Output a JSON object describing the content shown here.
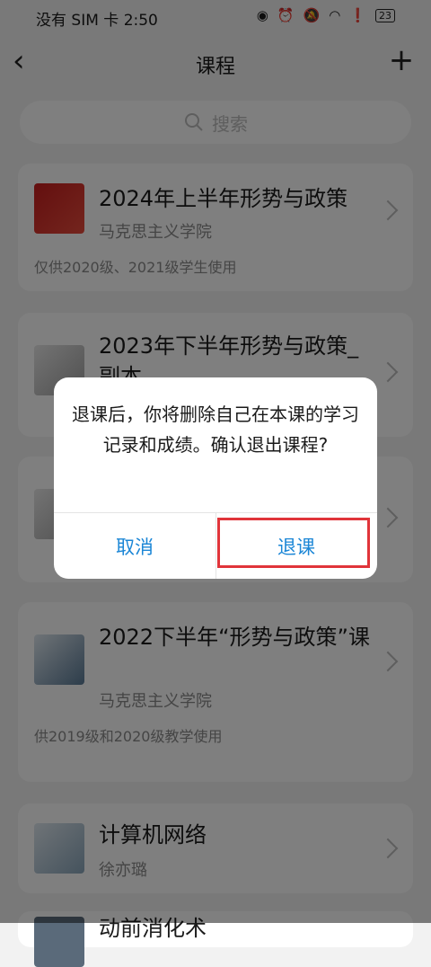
{
  "status_bar": {
    "carrier": "没有 SIM 卡",
    "time": "2:50",
    "battery": "23"
  },
  "header": {
    "title": "课程"
  },
  "search": {
    "placeholder": "搜索"
  },
  "courses": [
    {
      "title": "2024年上半年形势与政策",
      "teacher": "马克思主义学院",
      "note": "仅供2020级、2021级学生使用"
    },
    {
      "title": "2023年下半年形势与政策_副本",
      "teacher": "",
      "note": ""
    },
    {
      "title": "",
      "teacher": "",
      "note": ""
    },
    {
      "title": "2022下半年“形势与政策”课",
      "teacher": "马克思主义学院",
      "note": "供2019级和2020级教学使用"
    },
    {
      "title": "计算机网络",
      "teacher": "徐亦璐",
      "note": ""
    },
    {
      "title": "动前消化术",
      "teacher": "",
      "note": ""
    }
  ],
  "dialog": {
    "message": "退课后，你将删除自己在本课的学习记录和成绩。确认退出课程?",
    "cancel_label": "取消",
    "confirm_label": "退课"
  },
  "colors": {
    "accent": "#1b86d6",
    "highlight": "#e0343a"
  }
}
